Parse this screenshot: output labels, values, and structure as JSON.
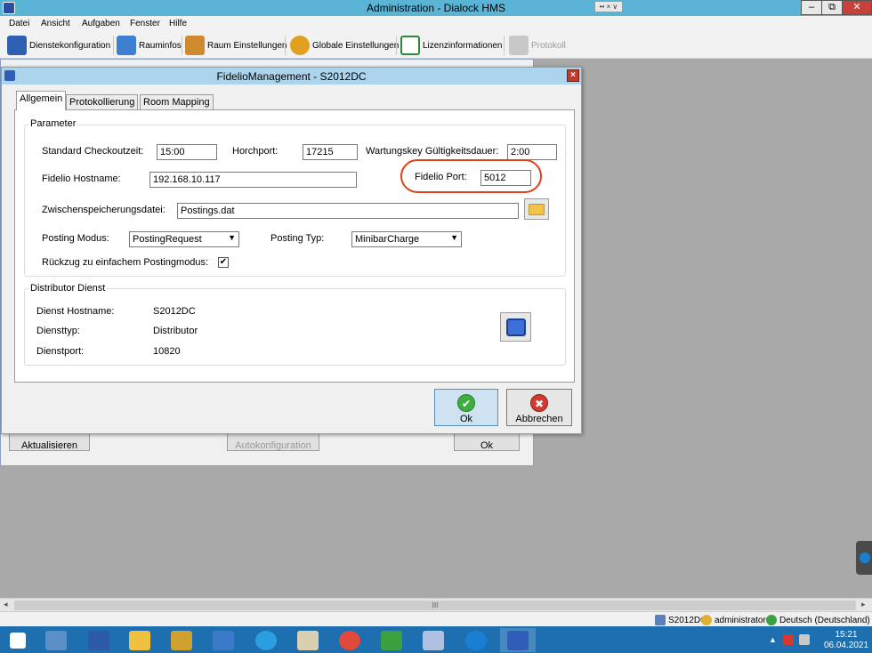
{
  "window": {
    "title": "Administration - Dialock HMS",
    "title_extra": "•• × ∨",
    "min_label": "–",
    "max_label": "⧉",
    "close_label": "✕"
  },
  "menu": [
    "Datei",
    "Ansicht",
    "Aufgaben",
    "Fenster",
    "Hilfe"
  ],
  "toolbar": [
    {
      "label": "Dienstekonfiguration",
      "icon": "services-icon",
      "color": "#2e5fb0"
    },
    {
      "label": "Rauminfos",
      "icon": "rooms-icon",
      "color": "#3d7fd0"
    },
    {
      "label": "Raum Einstellungen",
      "icon": "room-settings-icon",
      "color": "#d08a2e"
    },
    {
      "label": "Globale Einstellungen",
      "icon": "global-settings-icon",
      "color": "#e0a020"
    },
    {
      "label": "Lizenzinformationen",
      "icon": "license-icon",
      "color": "#2a8a3a"
    },
    {
      "label": "Protokoll",
      "icon": "protocol-icon",
      "color": "#b0b0b0",
      "disabled": true
    }
  ],
  "background_window": {
    "refresh_label": "Aktualisieren",
    "autoconfig_label": "Autokonfiguration",
    "ok_label": "Ok"
  },
  "dialog": {
    "title": "FidelioManagement - S2012DC",
    "close_label": "×",
    "tabs": [
      "Allgemein",
      "Protokollierung",
      "Room Mapping"
    ],
    "active_tab": 0,
    "parameter_group": {
      "label": "Parameter",
      "checkout_label": "Standard Checkoutzeit:",
      "checkout_value": "15:00",
      "listen_port_label": "Horchport:",
      "listen_port_value": "17215",
      "maintenance_label": "Wartungskey Gültigkeitsdauer:",
      "maintenance_value": "2:00",
      "hostname_label": "Fidelio Hostname:",
      "hostname_value": "192.168.10.117",
      "port_label": "Fidelio Port:",
      "port_value": "5012",
      "cache_label": "Zwischenspeicherungsdatei:",
      "cache_value": "Postings.dat",
      "posting_mode_label": "Posting Modus:",
      "posting_mode_value": "PostingRequest",
      "posting_type_label": "Posting Typ:",
      "posting_type_value": "MinibarCharge",
      "fallback_label": "Rückzug zu einfachem Postingmodus:",
      "fallback_checked": true,
      "check_mark": "✔"
    },
    "distributor_group": {
      "label": "Distributor Dienst",
      "host_label": "Dienst Hostname:",
      "host_value": "S2012DC",
      "type_label": "Diensttyp:",
      "type_value": "Distributor",
      "port_label": "Dienstport:",
      "port_value": "10820"
    },
    "ok_label": "Ok",
    "ok_icon_glyph": "✔",
    "cancel_label": "Abbrechen",
    "cancel_icon_glyph": "✖"
  },
  "scrollbar": {
    "left": "◂",
    "right": "▸",
    "grip": "III"
  },
  "status": {
    "server": "S2012DC",
    "user": "administrator",
    "language": "Deutsch (Deutschland)"
  },
  "taskbar": {
    "apps": [
      {
        "name": "start-button",
        "color": "#ffffff"
      },
      {
        "name": "server-manager",
        "color": "#5b8fc8"
      },
      {
        "name": "powershell",
        "color": "#2d5aa8"
      },
      {
        "name": "file-explorer",
        "color": "#f0c040"
      },
      {
        "name": "user-tool",
        "color": "#d0a030"
      },
      {
        "name": "network-tool",
        "color": "#3a7ac8"
      },
      {
        "name": "internet-explorer",
        "color": "#2a9ee0"
      },
      {
        "name": "notepad",
        "color": "#d8d0b0"
      },
      {
        "name": "chrome",
        "color": "#e04a3a"
      },
      {
        "name": "vbox-app",
        "color": "#3aa040"
      },
      {
        "name": "dialock-admin",
        "color": "#b0c0e0"
      },
      {
        "name": "teamviewer",
        "color": "#1a7fd4"
      },
      {
        "name": "dialock-hms",
        "color": "#2f5db8"
      }
    ],
    "tray_arrow": "▲",
    "time": "15:21",
    "date": "06.04.2021"
  }
}
